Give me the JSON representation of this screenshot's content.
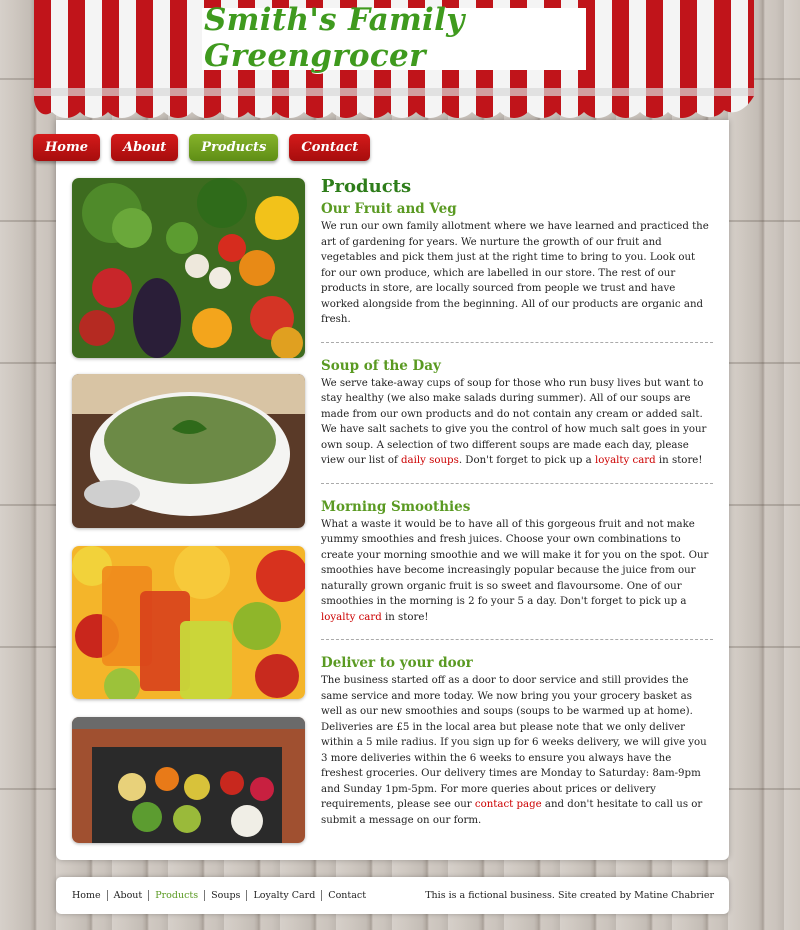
{
  "header": {
    "title": "Smith's Family Greengrocer"
  },
  "nav": [
    "Home",
    "About",
    "Products",
    "Contact"
  ],
  "photos": [
    {
      "name": "vegetables-photo",
      "subject": "vegetables"
    },
    {
      "name": "soup-photo",
      "subject": "soup"
    },
    {
      "name": "smoothies-photo",
      "subject": "smoothies"
    },
    {
      "name": "delivery-crate-photo",
      "subject": "crate"
    }
  ],
  "main": {
    "title": "Products",
    "sections": [
      {
        "heading": "Our Fruit and Veg",
        "text": "We run our own family allotment where we have learned and practiced the art of gardening for years. We nurture the growth of our fruit and vegetables and pick them just at the right time to bring to you. Look out for our own produce, which are labelled in our store. The rest of our products in store, are locally sourced from people we trust and have worked alongside from the beginning. All of our products are organic and fresh."
      },
      {
        "heading": "Soup of the Day",
        "text_a": "We serve take-away cups of soup for those who run busy lives but want to stay healthy (we also make salads during summer). All of our soups are made from our own products and do not contain any cream or added salt. We have salt sachets to give you the control of how much salt goes in your own soup. A selection of two different soups are made each day, please view our list of ",
        "link1": "daily soups",
        "text_b": ". Don't forget to pick up a ",
        "link2": "loyalty card",
        "text_c": " in store!"
      },
      {
        "heading": "Morning Smoothies",
        "text_a": "What a waste it would be to have all of this gorgeous fruit and not make yummy smoothies and fresh juices. Choose your own combinations to create your morning smoothie and we will make it for you on the spot. Our smoothies have become increasingly popular because the juice from our naturally grown organic fruit is so sweet and flavoursome. One of our smoothies in the morning is 2 fo your 5 a day. Don't forget to pick up a ",
        "link1": "loyalty card",
        "text_b": " in store!"
      },
      {
        "heading": "Deliver to your door",
        "text_a": "The business started off as a door to door service and still provides the same service and more today. We now bring you your grocery basket as well as our new smoothies and soups (soups to be warmed up at home). Deliveries are £5 in the local area but please note that we only deliver within a 5 mile radius. If you sign up for 6 weeks delivery, we will give you 3 more deliveries within the 6 weeks to ensure you always have the freshest groceries. Our delivery times are Monday to Saturday: 8am-9pm and Sunday 1pm-5pm. For more queries about prices or delivery requirements, please see our ",
        "link1": "contact page",
        "text_b": " and don't hesitate to call us or submit a message on our form."
      }
    ]
  },
  "footer": {
    "links": [
      "Home",
      "About",
      "Products",
      "Soups",
      "Loyalty Card",
      "Contact"
    ],
    "credit": "This is a fictional business. Site created by Matine Chabrier"
  },
  "colors": {
    "brand_red": "#c0141a",
    "brand_green": "#5a9a22",
    "heading_green": "#2e7d1a"
  }
}
